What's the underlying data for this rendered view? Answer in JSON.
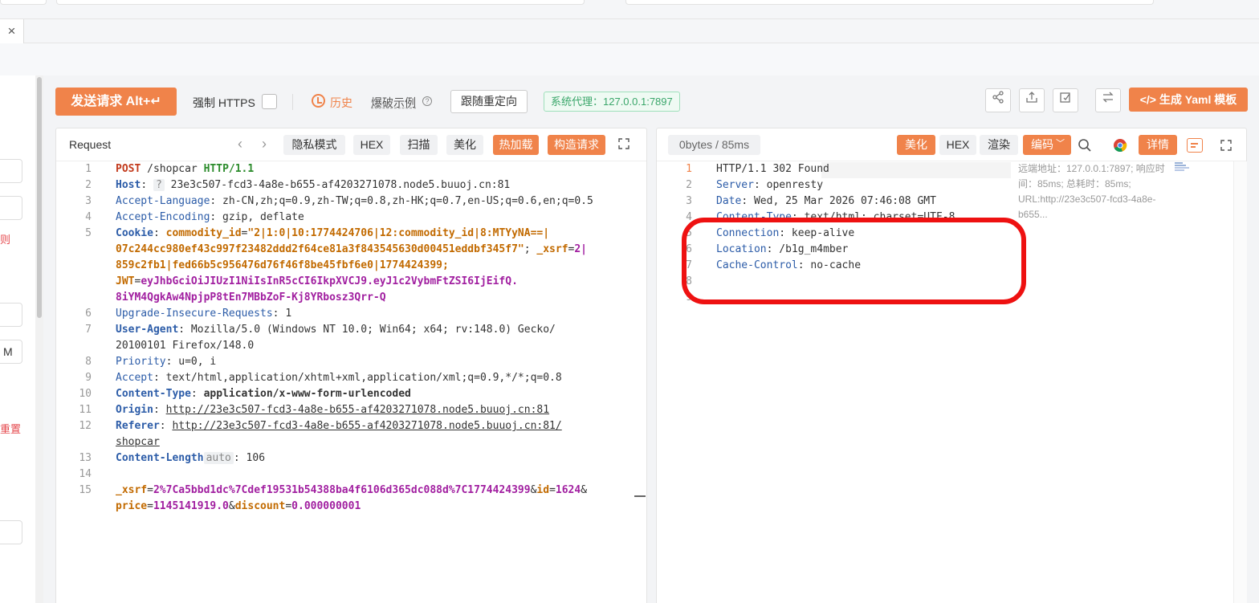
{
  "tab": {
    "close_label": "×"
  },
  "left_panel": {
    "link_red_1": "则",
    "input_partial": "M",
    "link_red_2": "重置"
  },
  "toolbar": {
    "send_label": "发送请求 Alt+↵",
    "force_https_label": "强制 HTTPS",
    "history_label": "历史",
    "fuzz_label": "爆破示例",
    "follow_redirect_label": "跟随重定向",
    "proxy_label": "系统代理：127.0.0.1:7897",
    "yaml_label": "</> 生成 Yaml 模板",
    "icons": [
      "share-icon",
      "upload-icon",
      "edit-icon",
      "swap-icon"
    ]
  },
  "request": {
    "title": "Request",
    "buttons": {
      "privacy": "隐私模式",
      "hex": "HEX",
      "scan": "扫描",
      "beautify": "美化",
      "hot_load": "热加载",
      "construct": "构造请求"
    },
    "line_numbers": [
      "1",
      "2",
      "3",
      "4",
      "5",
      "",
      "",
      "",
      "",
      "6",
      "7",
      "",
      "8",
      "9",
      "10",
      "11",
      "12",
      "",
      "13",
      "14",
      "15",
      ""
    ],
    "lines": {
      "l1_method": "POST",
      "l1_path": " /shopcar ",
      "l1_proto": "HTTP/1.1",
      "l2_key": "Host",
      "l2_badge": "?",
      "l2_val": " 23e3c507-fcd3-4a8e-b655-af4203271078.node5.buuoj.cn:81",
      "l3_key": "Accept-Language",
      "l3_val": " zh-CN,zh;q=0.9,zh-TW;q=0.8,zh-HK;q=0.7,en-US;q=0.6,en;q=0.5",
      "l4_key": "Accept-Encoding",
      "l4_val": " gzip, deflate",
      "l5_key": "Cookie",
      "l5_c1k": " commodity_id",
      "l5_c1v": "\"2|1:0|10:1774424706|12:commodity_id|8:MTYyNA==|",
      "l5b": "07c244cc980ef43c997f23482ddd2f64ce81a3f843545630d00451eddbf345f7\"",
      "l5b_k": " _xsrf",
      "l5b_v": "2|",
      "l5c": "859c2fb1|fed66b5c956476d76f46f8be45fbf6e0|1774424399;",
      "l5d_k": "JWT",
      "l5d_v": "eyJhbGciOiJIUzI1NiIsInR5cCI6IkpXVCJ9.eyJ1c2VybmFtZSI6IjEifQ.",
      "l5e": "8iYM4QgkAw4NpjpP8tEn7MBbZoF-Kj8YRbosz3Qrr-Q",
      "l6_key": "Upgrade-Insecure-Requests",
      "l6_val": " 1",
      "l7_key": "User-Agent",
      "l7_val": " Mozilla/5.0 (Windows NT 10.0; Win64; x64; rv:148.0) Gecko/",
      "l7b": "20100101 Firefox/148.0",
      "l8_key": "Priority",
      "l8_val": " u=0, i",
      "l9_key": "Accept",
      "l9_val": " text/html,application/xhtml+xml,application/xml;q=0.9,*/*;q=0.8",
      "l10_key": "Content-Type",
      "l10_val": " application/x-www-form-urlencoded",
      "l11_key": "Origin",
      "l11_val": "http://23e3c507-fcd3-4a8e-b655-af4203271078.node5.buuoj.cn:81",
      "l12_key": "Referer",
      "l12_val": "http://23e3c507-fcd3-4a8e-b655-af4203271078.node5.buuoj.cn:81/",
      "l12b": "shopcar",
      "l13_key": "Content-Length",
      "l13_badge": "auto",
      "l13_val": " 106",
      "l15_k1": "_xsrf",
      "l15_v1": "2%7Ca5bbd1dc%7Cdef19531b54388ba4f6106d365dc088d%7C1774424399",
      "l15_k2": "id",
      "l15_v2": "1624",
      "l15_k3": "price",
      "l15_v3": "1145141919.0",
      "l15_k4": "discount",
      "l15_v4": "0.000000001"
    }
  },
  "response": {
    "stats": "0bytes / 85ms",
    "buttons": {
      "beautify": "美化",
      "hex": "HEX",
      "render": "渲染",
      "encoding": "编码",
      "details": "详情"
    },
    "line_numbers": [
      "1",
      "2",
      "3",
      "4",
      "5",
      "6",
      "7",
      "8",
      "9"
    ],
    "lines": {
      "r1": "HTTP/1.1 302 Found",
      "r2_key": "Server",
      "r2_val": " openresty",
      "r3_key": "Date",
      "r3_val": " Wed, 25 Mar 2026 07:46:08 GMT",
      "r4_key": "Content-Type",
      "r4_val": " text/html; charset=UTF-8",
      "r5_key": "Connection",
      "r5_val": " keep-alive",
      "r6_key": "Location",
      "r6_val": " /b1g_m4mber",
      "r7_key": "Cache-Control",
      "r7_val": " no-cache"
    },
    "side_note": "远端地址：127.0.0.1:7897; 响应时间：85ms; 总耗时：85ms; URL:http://23e3c507-fcd3-4a8e-b655..."
  },
  "colors": {
    "accent": "#f0834a",
    "highlight": "#ee1111",
    "proxy_green": "#3aa66a"
  }
}
